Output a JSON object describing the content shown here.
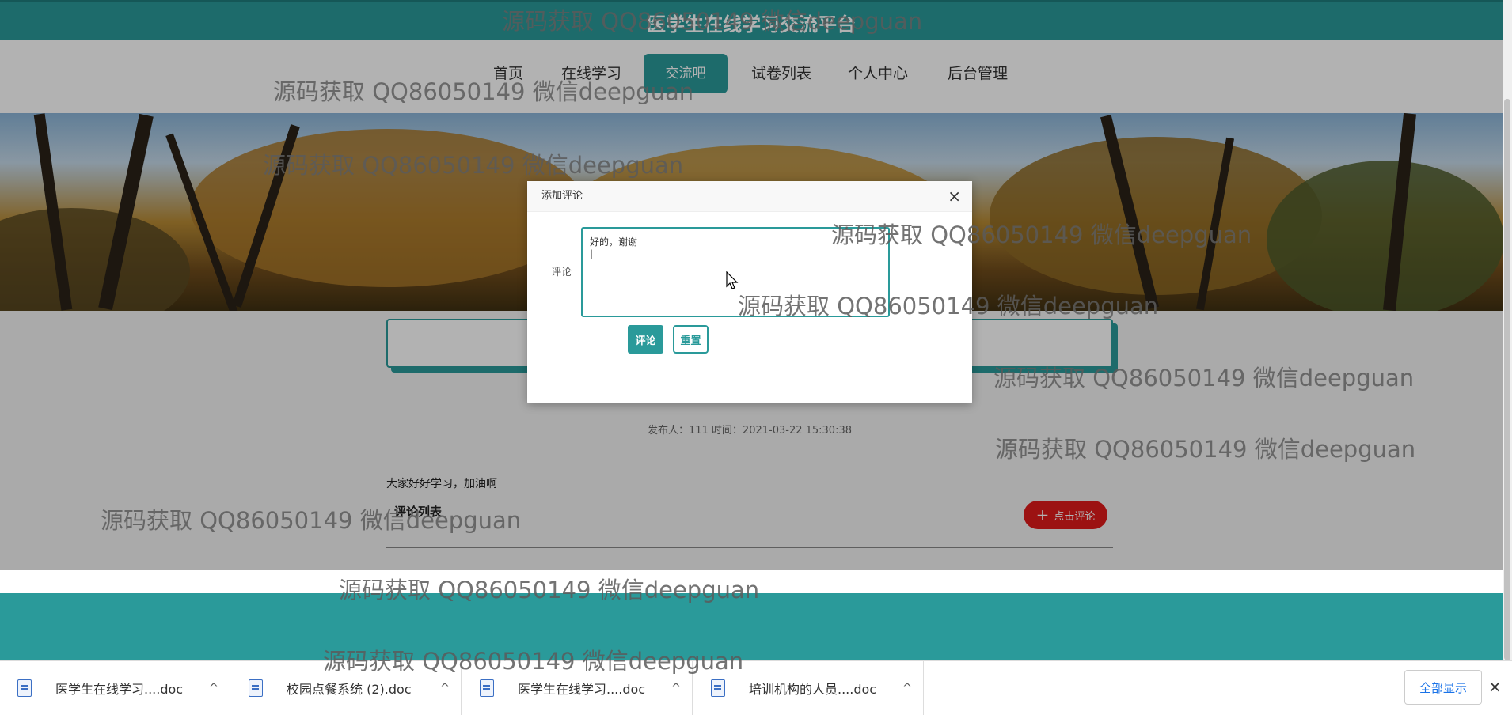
{
  "site": {
    "title": "医学生在线学习交流平台"
  },
  "nav": {
    "items": [
      {
        "label": "首页"
      },
      {
        "label": "在线学习"
      },
      {
        "label": "交流吧"
      },
      {
        "label": "试卷列表"
      },
      {
        "label": "个人中心"
      },
      {
        "label": "后台管理"
      }
    ],
    "active_index": 2
  },
  "post": {
    "meta": "发布人：111 时间：2021-03-22 15:30:38",
    "content": "大家好好学习，加油啊",
    "comment_list_title": "评论列表",
    "comment_button": "点击评论"
  },
  "modal": {
    "title": "添加评论",
    "close_symbol": "×",
    "field_label": "评论",
    "textarea_value": "好的，谢谢\n|",
    "submit_label": "评论",
    "reset_label": "重置"
  },
  "downloads": {
    "items": [
      {
        "name": "医学生在线学习....doc"
      },
      {
        "name": "校园点餐系统 (2).doc"
      },
      {
        "name": "医学生在线学习....doc"
      },
      {
        "name": "培训机构的人员....doc"
      }
    ],
    "chevron": "^",
    "show_all": "全部显示",
    "close_symbol": "×"
  },
  "watermark": "源码获取 QQ86050149 微信deepguan",
  "colors": {
    "accent": "#2a9a9a",
    "danger": "#e01b1b"
  }
}
